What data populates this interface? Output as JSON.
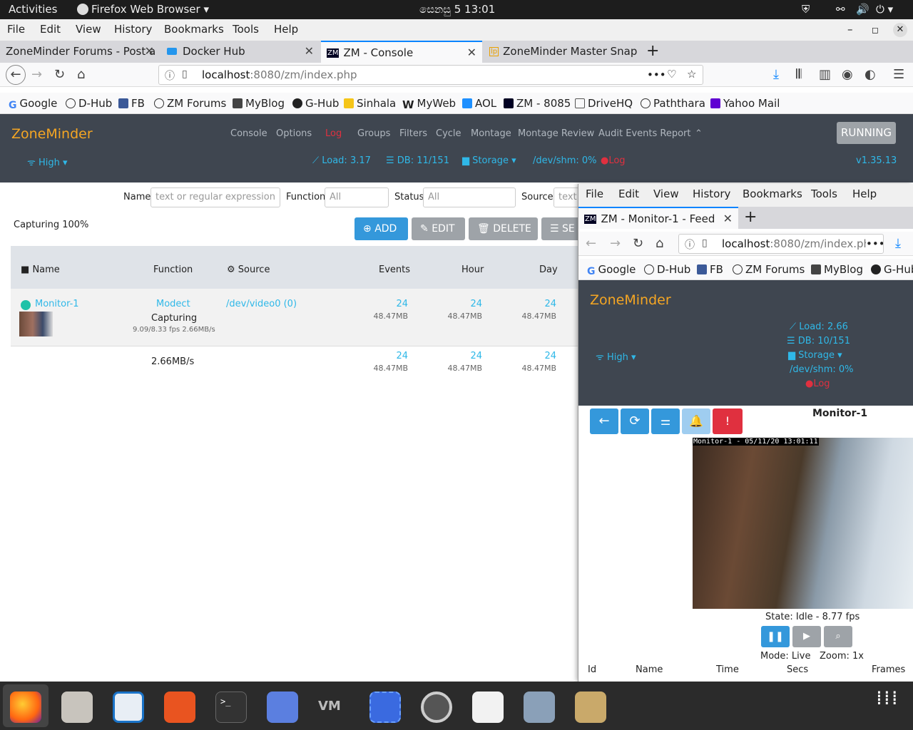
{
  "gnome": {
    "activities": "Activities",
    "app_name": "Firefox Web Browser",
    "clock": "සෙනසු 5  13:01"
  },
  "main_window": {
    "menu": [
      "File",
      "Edit",
      "View",
      "History",
      "Bookmarks",
      "Tools",
      "Help"
    ],
    "tabs": [
      {
        "label": "ZoneMinder Forums - Post a"
      },
      {
        "label": "Docker Hub"
      },
      {
        "label": "ZM - Console"
      },
      {
        "label": "ZoneMinder Master Snap"
      }
    ],
    "url": {
      "host": "localhost",
      "rest": ":8080/zm/index.php"
    },
    "bookmarks": [
      "Google",
      "D-Hub",
      "FB",
      "ZM Forums",
      "MyBlog",
      "G-Hub",
      "Sinhala",
      "MyWeb",
      "AOL",
      "ZM - 8085",
      "DriveHQ",
      "Paththara",
      "Yahoo Mail"
    ]
  },
  "zm": {
    "brand": "ZoneMinder",
    "nav": [
      "Console",
      "Options",
      "Log",
      "Groups",
      "Filters",
      "Cycle",
      "Montage",
      "Montage Review",
      "Audit Events Report"
    ],
    "running": "RUNNING",
    "bandwidth": "High",
    "load": "Load: 3.17",
    "db": "DB: 11/151",
    "storage": "Storage",
    "shm": "/dev/shm: 0%",
    "log": "Log",
    "version": "v1.35.13",
    "filters": {
      "name_label": "Name",
      "name_placeholder": "text or regular expression",
      "function_label": "Function",
      "function_value": "All",
      "status_label": "Status",
      "status_value": "All",
      "source_label": "Source",
      "source_placeholder": "text o"
    },
    "capturing": "Capturing 100%",
    "buttons": {
      "add": "ADD",
      "edit": "EDIT",
      "delete": "DELETE",
      "select": "SE"
    },
    "table": {
      "headers": [
        "Name",
        "Function",
        "Source",
        "Events",
        "Hour",
        "Day"
      ],
      "row": {
        "name": "Monitor-1",
        "function": "Modect",
        "status": "Capturing",
        "fps": "9.09/8.33 fps 2.66MB/s",
        "source": "/dev/video0 (0)",
        "events": "24",
        "events_size": "48.47MB",
        "hour": "24",
        "hour_size": "48.47MB",
        "day": "24",
        "day_size": "48.47MB"
      },
      "totals": {
        "bandwidth": "2.66MB/s",
        "events": "24",
        "events_size": "48.47MB",
        "hour": "24",
        "hour_size": "48.47MB",
        "day": "24",
        "day_size": "48.47MB"
      }
    }
  },
  "popup": {
    "menu": [
      "File",
      "Edit",
      "View",
      "History",
      "Bookmarks",
      "Tools",
      "Help"
    ],
    "tab": "ZM - Monitor-1 - Feed",
    "url": {
      "host": "localhost",
      "rest": ":8080/zm/index.ph"
    },
    "bookmarks": [
      "Google",
      "D-Hub",
      "FB",
      "ZM Forums",
      "MyBlog",
      "G-Hub"
    ],
    "brand": "ZoneMinder",
    "load": "Load: 2.66",
    "db": "DB: 10/151",
    "storage": "Storage",
    "shm": "/dev/shm: 0%",
    "log": "Log",
    "bandwidth": "High",
    "monitor_title": "Monitor-1",
    "overlay": "Monitor-1 - 05/11/20 13:01:11",
    "state": "State: Idle - 8.77 fps",
    "mode": "Mode: Live",
    "zoom": "Zoom: 1x",
    "events_headers": [
      "Id",
      "Name",
      "Time",
      "Secs",
      "Frames"
    ]
  },
  "colors": {
    "accent": "#2fb8e8",
    "header": "#3f4650",
    "brand": "#f5a623",
    "add": "#3498db",
    "gray_btn": "#9ea3a8",
    "alert": "#e0303f"
  }
}
